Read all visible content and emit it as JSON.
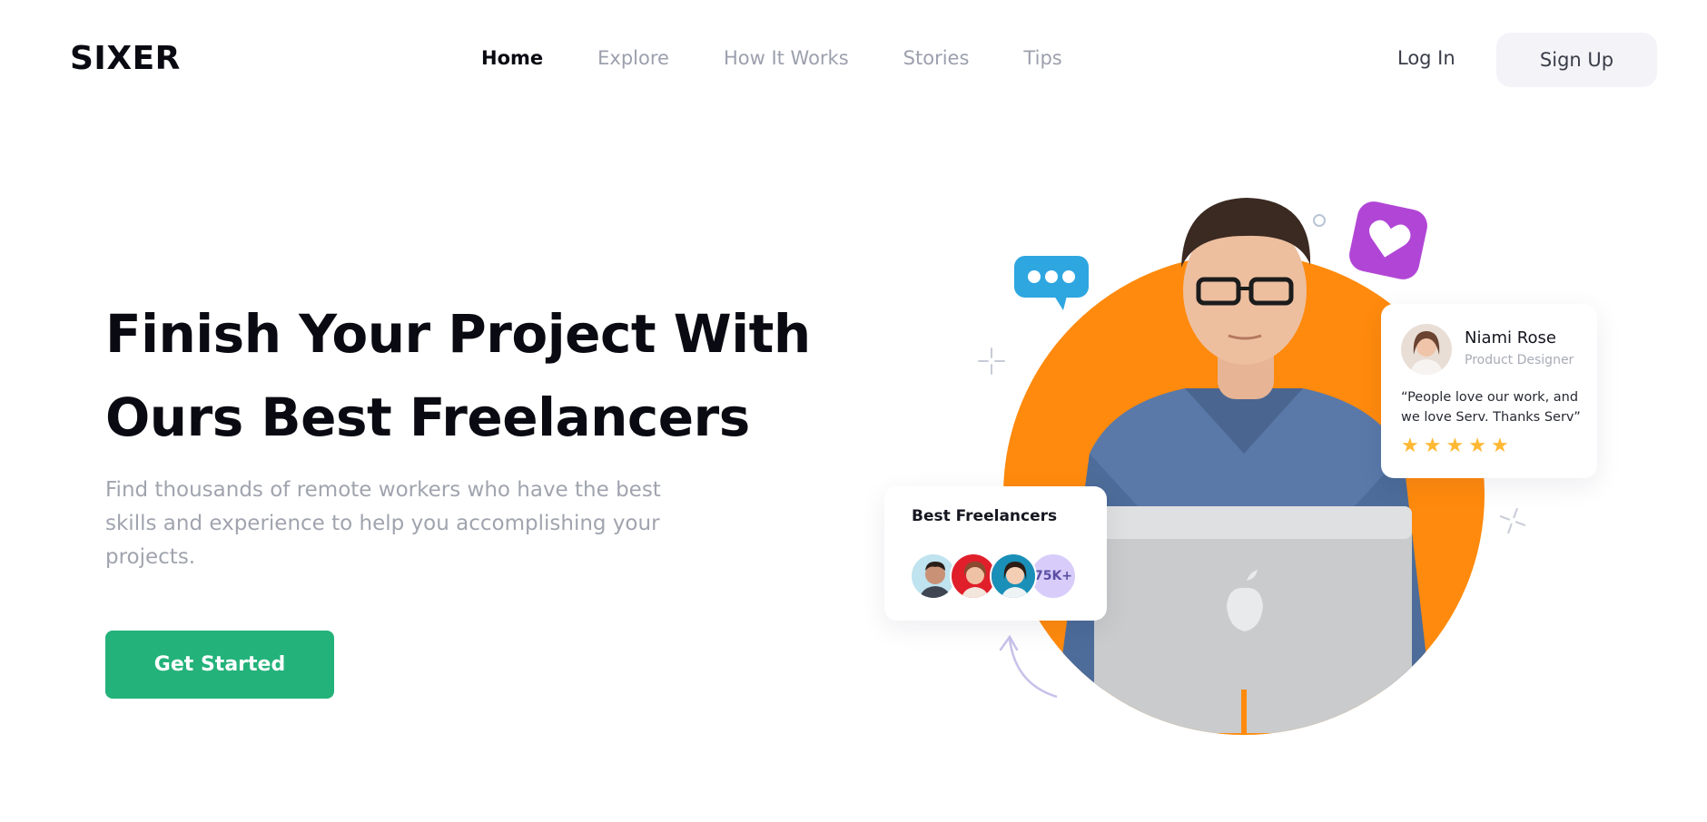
{
  "header": {
    "logo": "SIXER",
    "nav": [
      "Home",
      "Explore",
      "How It Works",
      "Stories",
      "Tips"
    ],
    "active_nav": "Home",
    "login_label": "Log In",
    "signup_label": "Sign Up"
  },
  "hero": {
    "title_line1": "Finish Your Project With",
    "title_line2": "Ours Best Freelancers",
    "subtitle": "Find thousands of remote workers who have the best skills and experience to help you accomplishing your projects.",
    "cta_label": "Get Started"
  },
  "freelancers_card": {
    "title": "Best Freelancers",
    "count": "75K+"
  },
  "review_card": {
    "name": "Niami Rose",
    "role": "Product Designer",
    "quote": "“People love our work, and we love Serv. Thanks Serv”",
    "rating": 5
  },
  "colors": {
    "accent_green": "#23b27a",
    "orange": "#ff8a0d",
    "chat_blue": "#2ea6e0",
    "heart_purple": "#b146d6",
    "star": "#ffb833"
  }
}
